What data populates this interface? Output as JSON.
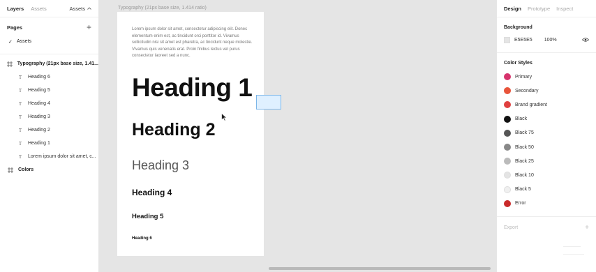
{
  "left_panel": {
    "tabs": {
      "layers": "Layers",
      "assets": "Assets",
      "assets_dropdown": "Assets"
    },
    "pages_title": "Pages",
    "pages": [
      {
        "label": "Assets",
        "selected": true
      }
    ],
    "frame_label": "Typography (21px base size, 1.41...",
    "layers": [
      {
        "label": "Heading 6"
      },
      {
        "label": "Heading 5"
      },
      {
        "label": "Heading 4"
      },
      {
        "label": "Heading 3"
      },
      {
        "label": "Heading 2"
      },
      {
        "label": "Heading 1"
      },
      {
        "label": "Lorem ipsum dolor sit amet, c..."
      }
    ],
    "colors_frame": "Colors"
  },
  "canvas": {
    "frame_title": "Typography (21px base size, 1.414 ratio)",
    "paragraph": "Lorem ipsum dolor sit amet, consectetur adipiscing elit. Donec elementum enim est, ac tincidunt orci porttitor id. Vivamus sollicitudin nisi sit amet est pharetra, ac tincidunt neque molestie. Vivamus quis venenatis erat. Proin finibus lectus vel purus consectetur laoreet sed a nunc.",
    "headings": {
      "h1": "Heading 1",
      "h2": "Heading 2",
      "h3": "Heading 3",
      "h4": "Heading 4",
      "h5": "Heading 5",
      "h6": "Heading 6"
    }
  },
  "right_panel": {
    "tabs": {
      "design": "Design",
      "prototype": "Prototype",
      "inspect": "Inspect"
    },
    "background": {
      "title": "Background",
      "hex": "E5E5E5",
      "opacity": "100%"
    },
    "color_styles_title": "Color Styles",
    "color_styles": [
      {
        "label": "Primary",
        "color": "#d6336c"
      },
      {
        "label": "Secondary",
        "color": "#e8543a"
      },
      {
        "label": "Brand gradient",
        "color": "#e0403f"
      },
      {
        "label": "Black",
        "color": "#111111"
      },
      {
        "label": "Black 75",
        "color": "#555555"
      },
      {
        "label": "Black 50",
        "color": "#888888"
      },
      {
        "label": "Black 25",
        "color": "#bbbbbb"
      },
      {
        "label": "Black 10",
        "color": "#e4e4e4"
      },
      {
        "label": "Black 5",
        "color": "#f0f0f0"
      },
      {
        "label": "Error",
        "color": "#c92a2a"
      }
    ],
    "export_label": "Export"
  }
}
